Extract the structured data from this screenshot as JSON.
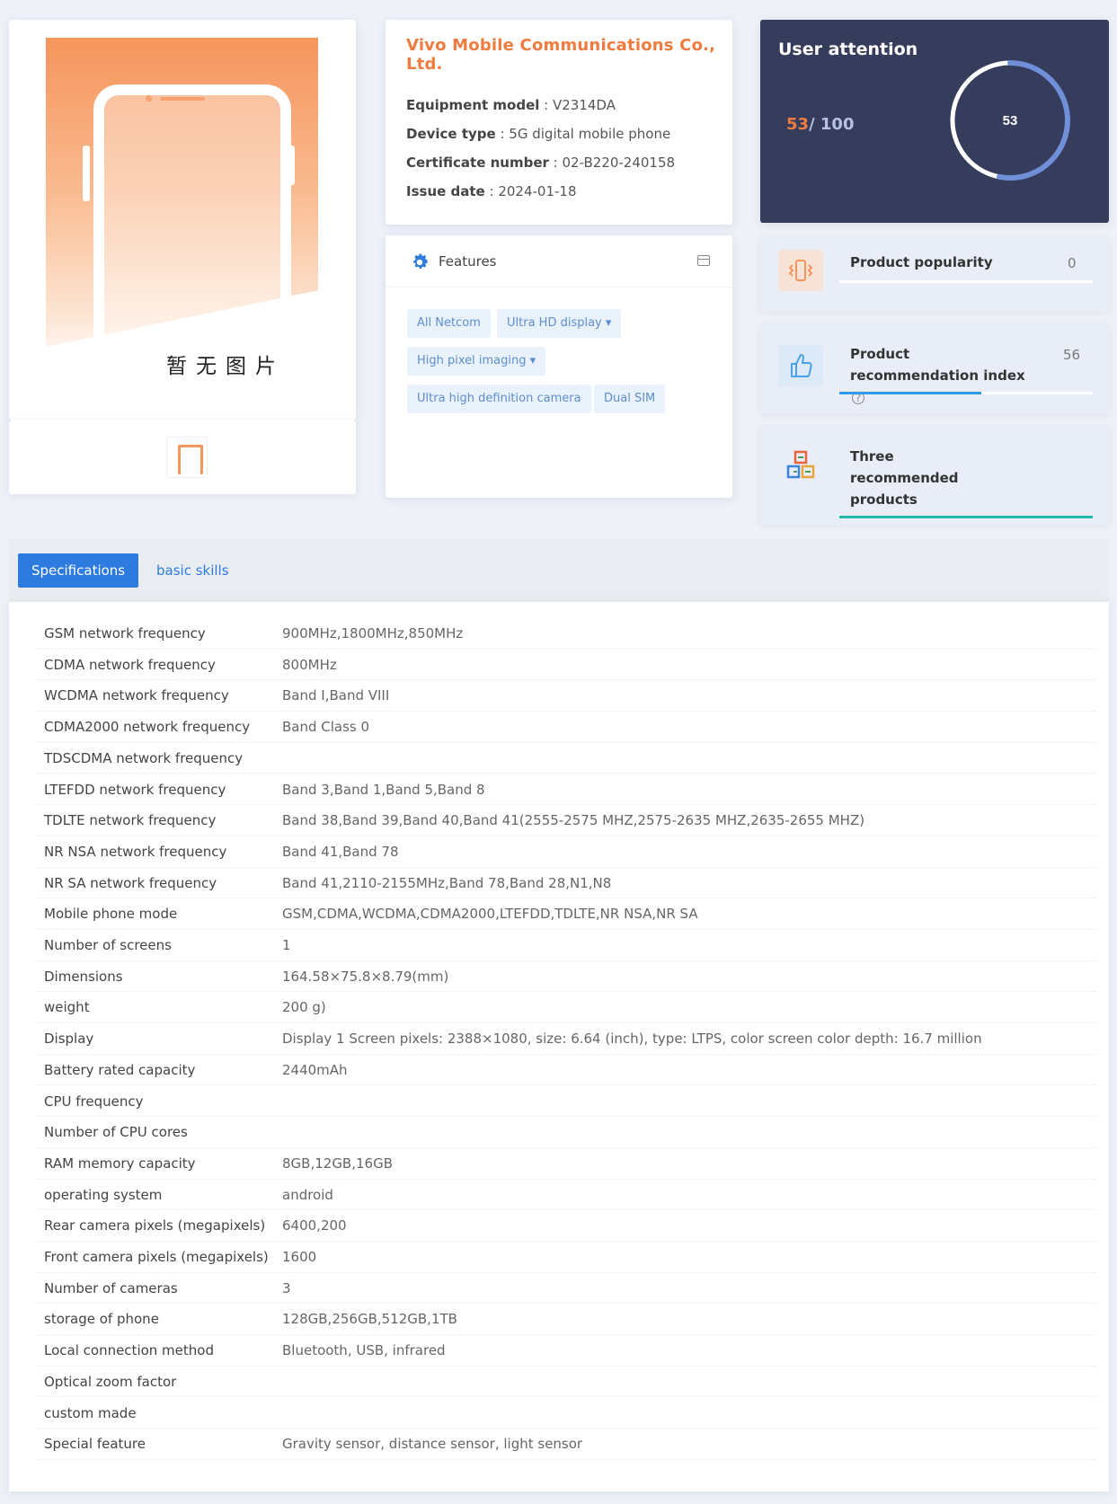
{
  "image": {
    "placeholder_text": "暂无图片"
  },
  "company": {
    "name": "Vivo Mobile Communications Co., Ltd.",
    "fields": [
      {
        "label": "Equipment model",
        "value": "V2314DA"
      },
      {
        "label": "Device type",
        "value": "5G digital mobile phone"
      },
      {
        "label": "Certificate number",
        "value": "02-B220-240158"
      },
      {
        "label": "Issue date",
        "value": "2024-01-18"
      }
    ]
  },
  "attention": {
    "title": "User attention",
    "current": "53",
    "max": "/ 100",
    "ring_value": "53",
    "ring_fraction": 0.53
  },
  "features": {
    "title": "Features",
    "tags": [
      "All Netcom",
      "Ultra HD display ▾",
      "High pixel imaging ▾",
      "Ultra high definition camera",
      "Dual SIM"
    ]
  },
  "stats": {
    "popularity": {
      "label": "Product popularity",
      "value": "0",
      "fraction": 0.0
    },
    "recommendation": {
      "label": "Product recommendation index",
      "help": "?",
      "value": "56",
      "fraction": 0.56
    },
    "three": {
      "label_lines": [
        "Three",
        "recommended",
        "products"
      ],
      "fraction": 1.0
    }
  },
  "colors": {
    "accent": "#2e7be0",
    "orange": "#f07b3f",
    "dark_panel": "#363c5c",
    "bar_blue": "#2f9be6",
    "bar_teal": "#23b8a8"
  },
  "tabs": {
    "specifications": "Specifications",
    "basic_skills": "basic skills"
  },
  "specs": [
    {
      "k": "GSM network frequency",
      "v": "900MHz,1800MHz,850MHz"
    },
    {
      "k": "CDMA network frequency",
      "v": "800MHz"
    },
    {
      "k": "WCDMA network frequency",
      "v": "Band I,Band VIII"
    },
    {
      "k": "CDMA2000 network frequency",
      "v": "Band Class 0"
    },
    {
      "k": "TDSCDMA network frequency",
      "v": ""
    },
    {
      "k": "LTEFDD network frequency",
      "v": "Band 3,Band 1,Band 5,Band 8"
    },
    {
      "k": "TDLTE network frequency",
      "v": "Band 38,Band 39,Band 40,Band 41(2555-2575 MHZ,2575-2635 MHZ,2635-2655 MHZ)"
    },
    {
      "k": "NR NSA network frequency",
      "v": "Band 41,Band 78"
    },
    {
      "k": "NR SA network frequency",
      "v": "Band 41,2110-2155MHz,Band 78,Band 28,N1,N8"
    },
    {
      "k": "Mobile phone mode",
      "v": "GSM,CDMA,WCDMA,CDMA2000,LTEFDD,TDLTE,NR NSA,NR SA"
    },
    {
      "k": "Number of screens",
      "v": "1"
    },
    {
      "k": "Dimensions",
      "v": "164.58×75.8×8.79(mm)"
    },
    {
      "k": "weight",
      "v": "200 g)"
    },
    {
      "k": "Display",
      "v": "Display 1 Screen pixels: 2388×1080, size: 6.64 (inch), type: LTPS, color screen color depth: 16.7 million"
    },
    {
      "k": "Battery rated capacity",
      "v": "2440mAh"
    },
    {
      "k": "CPU frequency",
      "v": ""
    },
    {
      "k": "Number of CPU cores",
      "v": ""
    },
    {
      "k": "RAM memory capacity",
      "v": "8GB,12GB,16GB"
    },
    {
      "k": "operating system",
      "v": "android"
    },
    {
      "k": "Rear camera pixels (megapixels)",
      "v": "6400,200"
    },
    {
      "k": "Front camera pixels (megapixels)",
      "v": "1600"
    },
    {
      "k": "Number of cameras",
      "v": "3"
    },
    {
      "k": "storage of phone",
      "v": "128GB,256GB,512GB,1TB"
    },
    {
      "k": "Local connection method",
      "v": "Bluetooth, USB, infrared"
    },
    {
      "k": "Optical zoom factor",
      "v": ""
    },
    {
      "k": "custom made",
      "v": ""
    },
    {
      "k": "Special feature",
      "v": "Gravity sensor, distance sensor, light sensor"
    }
  ]
}
